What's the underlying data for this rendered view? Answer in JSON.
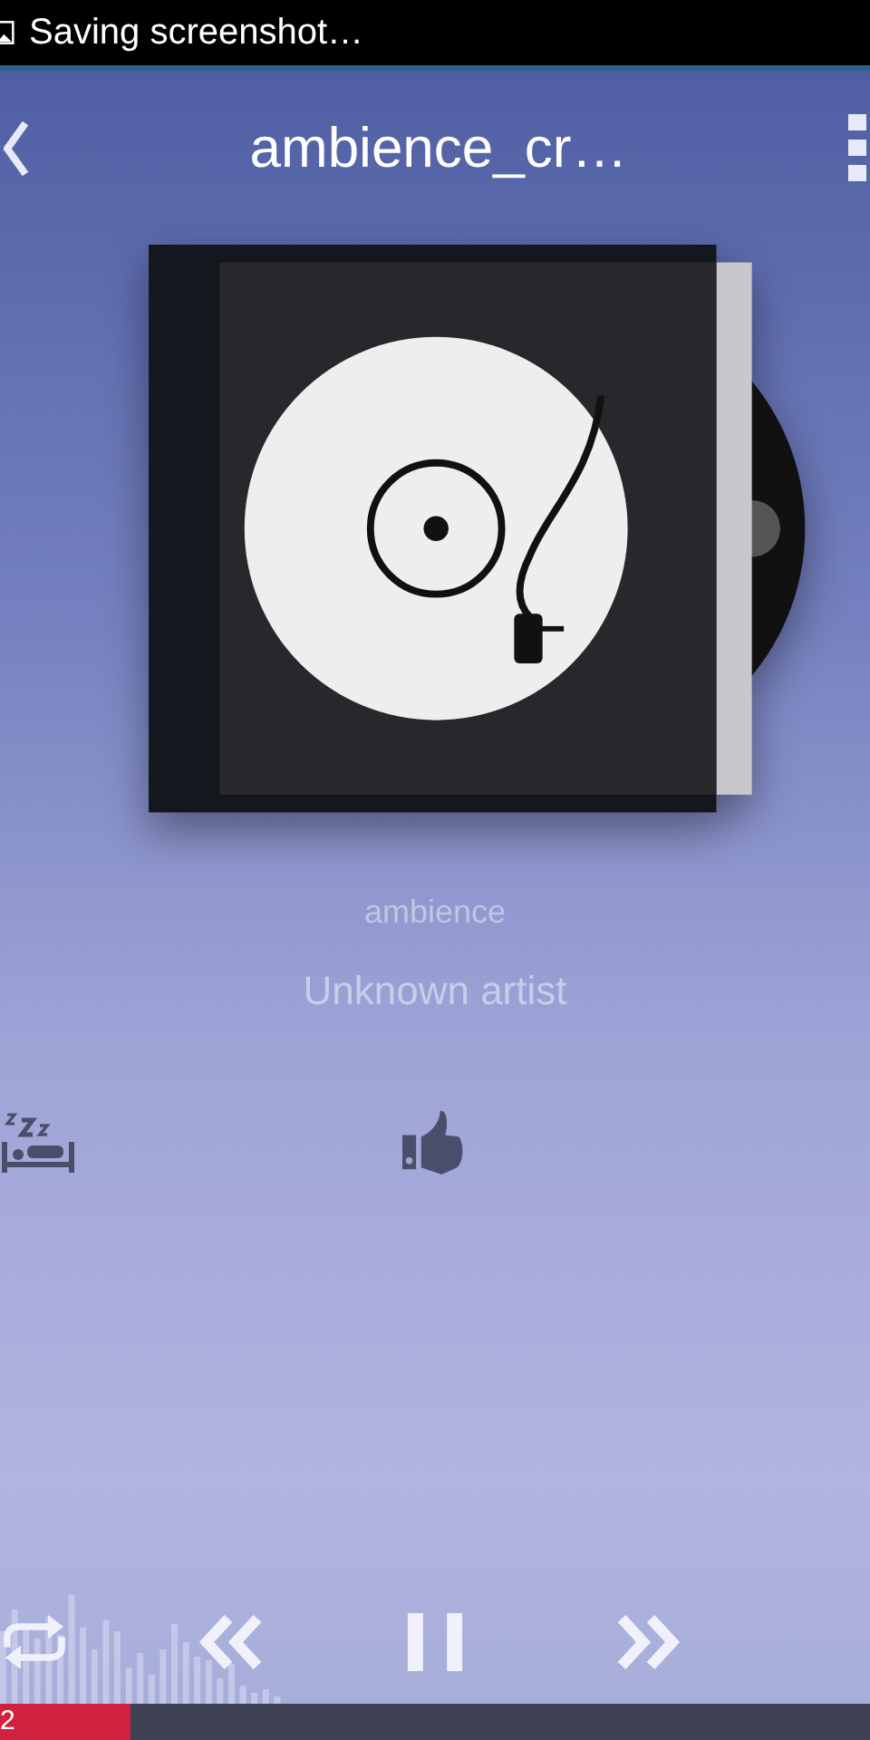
{
  "status_bar": {
    "notification": "Saving screenshot…"
  },
  "header": {
    "title": "ambience_cr…"
  },
  "track": {
    "album": "ambience",
    "artist": "Unknown artist"
  },
  "progress": {
    "level": 0.15,
    "elapsed": "2"
  }
}
